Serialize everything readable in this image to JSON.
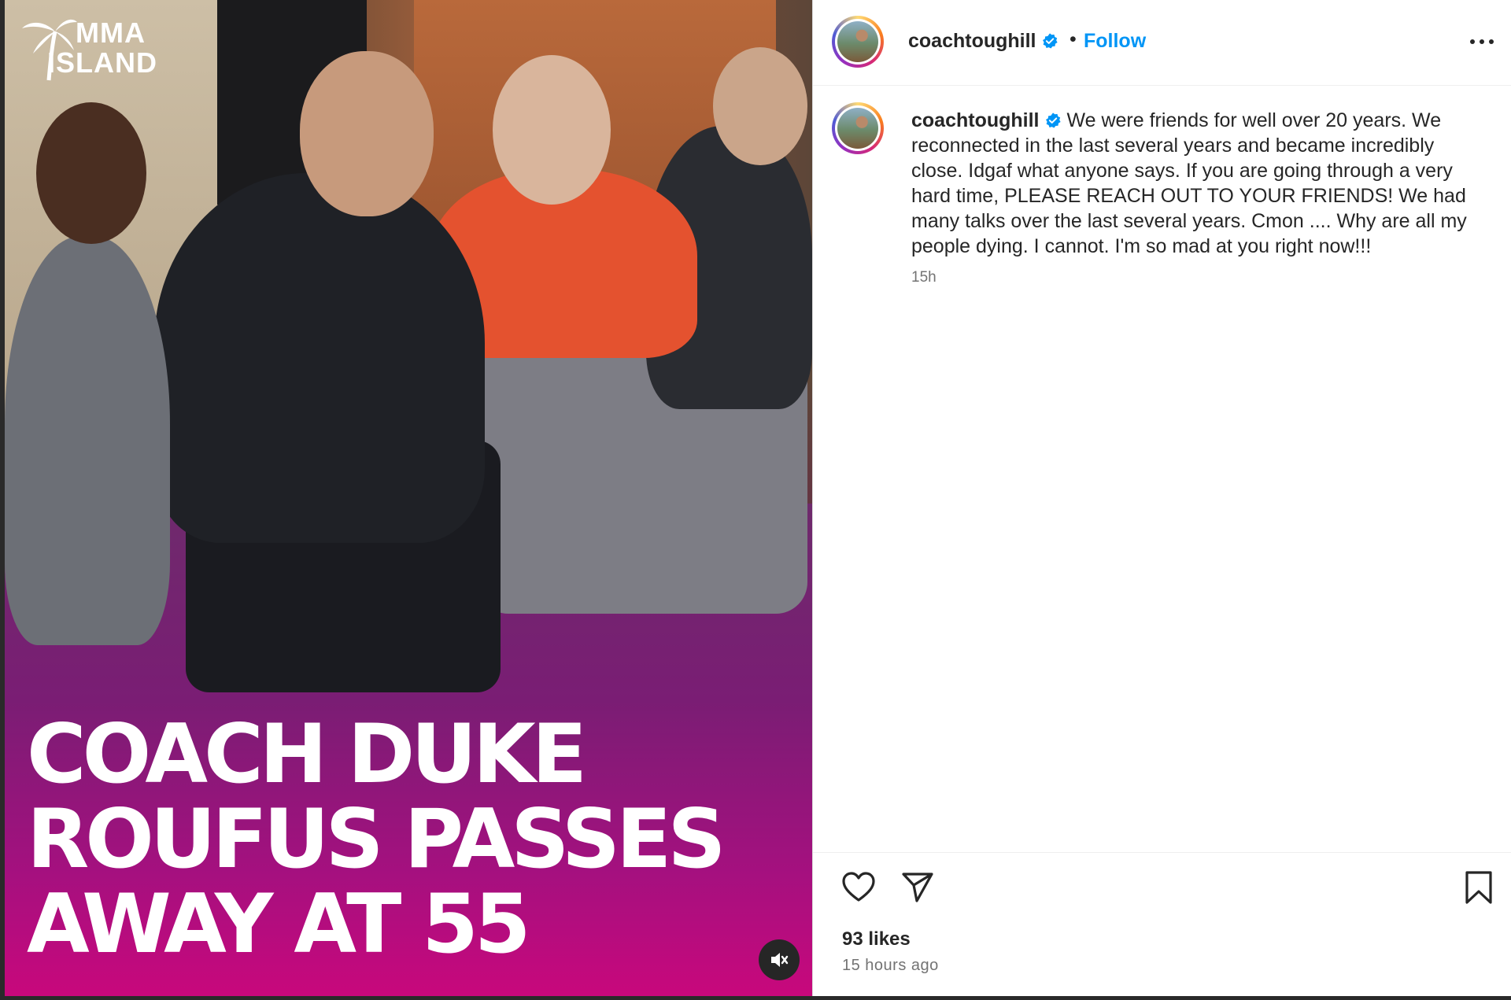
{
  "media": {
    "logo_line1": "MMA",
    "logo_line2": "ISLAND",
    "headline_lines": [
      "COACH DUKE",
      "ROUFUS PASSES",
      "AWAY AT 55"
    ],
    "mute_icon": "speaker-muted-icon"
  },
  "header": {
    "username": "coachtoughill",
    "separator": "•",
    "follow_label": "Follow",
    "more_icon": "more-options-icon"
  },
  "caption": {
    "username": "coachtoughill",
    "text": "We were friends for well over 20 years. We reconnected in the last several years and became incredibly close. Idgaf what anyone says. If you are going through a very hard time, PLEASE REACH OUT TO YOUR FRIENDS! We had many talks over the last several years. Cmon .... Why are all my people dying. I cannot. I'm so mad at you right now!!!",
    "timestamp": "15h"
  },
  "actions": {
    "like_icon": "heart-icon",
    "share_icon": "paper-plane-icon",
    "save_icon": "bookmark-icon",
    "likes": "93 likes",
    "time_ago": "15 hours ago"
  },
  "colors": {
    "follow": "#0095f6",
    "verified": "#0095f6",
    "headline_bg": "#c8087c",
    "text": "#262626",
    "secondary_text": "#737373"
  }
}
